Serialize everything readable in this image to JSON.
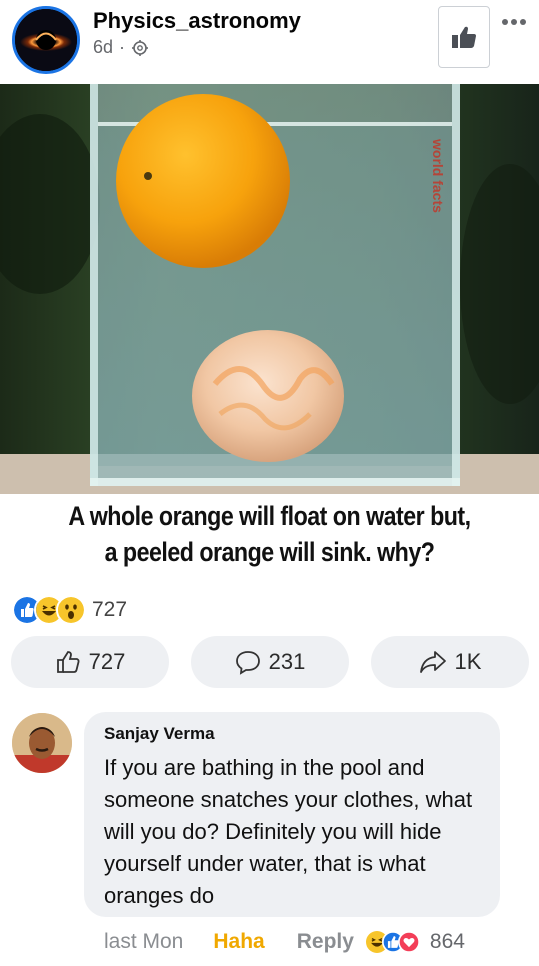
{
  "post": {
    "page_name": "Physics_astronomy",
    "time": "6d",
    "separator": "·",
    "caption_line1": "A whole orange will float on water but,",
    "caption_line2": "a peeled orange will sink. why?",
    "watermark": "world facts"
  },
  "reactions": {
    "count": "727",
    "types": [
      "like",
      "haha",
      "wow"
    ]
  },
  "actions": {
    "like_count": "727",
    "comment_count": "231",
    "share_count": "1K"
  },
  "comment": {
    "name": "Sanjay Verma",
    "text": "If you are bathing in the pool and someone snatches your clothes, what will you do? Definitely you will hide yourself under water, that is what oranges do",
    "time": "last Mon",
    "reaction_label": "Haha",
    "reply_label": "Reply",
    "reaction_count": "864"
  },
  "colors": {
    "brand_blue": "#1b74e4",
    "haha_yellow": "#f0a800",
    "bubble_gray": "#eef0f3"
  },
  "icons": [
    "globe-gear-icon",
    "thumbs-up-icon",
    "more-icon",
    "like-icon",
    "comment-icon",
    "share-icon"
  ]
}
